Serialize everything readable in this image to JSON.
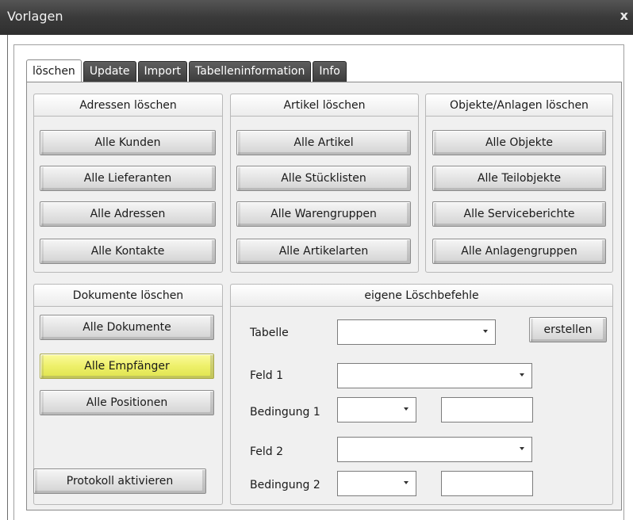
{
  "window": {
    "title": "Vorlagen",
    "close_label": "x"
  },
  "tabs": [
    "löschen",
    "Update",
    "Import",
    "Tabelleninformation",
    "Info"
  ],
  "groups": {
    "adressen": {
      "title": "Adressen löschen",
      "buttons": [
        "Alle Kunden",
        "Alle Lieferanten",
        "Alle Adressen",
        "Alle Kontakte"
      ]
    },
    "artikel": {
      "title": "Artikel löschen",
      "buttons": [
        "Alle Artikel",
        "Alle Stücklisten",
        "Alle Warengruppen",
        "Alle Artikelarten"
      ]
    },
    "objekte": {
      "title": "Objekte/Anlagen löschen",
      "buttons": [
        "Alle Objekte",
        "Alle Teilobjekte",
        "Alle Serviceberichte",
        "Alle Anlagengruppen"
      ]
    },
    "dokumente": {
      "title": "Dokumente löschen",
      "buttons": [
        "Alle Dokumente",
        "Alle Empfänger",
        "Alle Positionen"
      ],
      "protocol_button": "Protokoll aktivieren"
    },
    "eigene": {
      "title": "eigene Löschbefehle",
      "tabelle_label": "Tabelle",
      "tabelle_value": "",
      "erstellen_button": "erstellen",
      "feld1_label": "Feld 1",
      "feld1_value": "",
      "bedingung1_label": "Bedingung 1",
      "bedingung1_value": "",
      "wert1_value": "",
      "feld2_label": "Feld 2",
      "feld2_value": "",
      "bedingung2_label": "Bedingung 2",
      "bedingung2_value": "",
      "wert2_value": ""
    }
  },
  "colors": {
    "highlight_button": "#eef06a",
    "titlebar": "#3a3a3a"
  }
}
